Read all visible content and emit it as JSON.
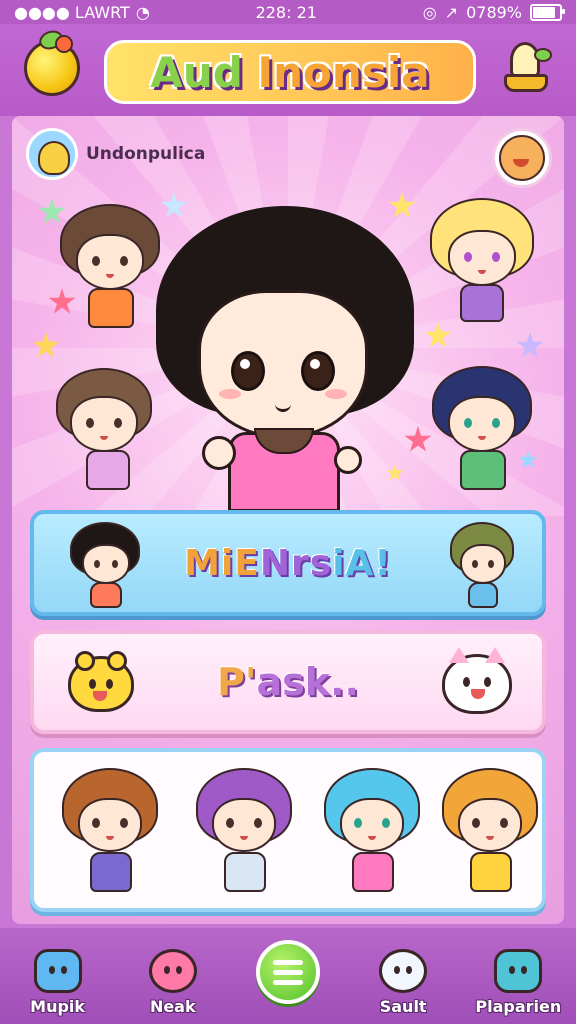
{
  "status_bar": {
    "carrier": "●●●● LAWRT",
    "time": "228: 21",
    "battery_text": "0789%",
    "battery_level": 0.78
  },
  "header": {
    "title_part1": "Aud",
    "title_part2": "Inonsia"
  },
  "profile": {
    "username": "Undonpulica"
  },
  "panels": {
    "banner_label_a": "MiE",
    "banner_label_b": "Nrs",
    "banner_label_c": "iA!",
    "pack_label_a": "P'",
    "pack_label_b": "ask.."
  },
  "bottom_nav": {
    "items": [
      {
        "label": "Mupik",
        "icon": "blue-cat-icon"
      },
      {
        "label": "Neak",
        "icon": "pink-bear-icon"
      },
      {
        "label": "",
        "icon": "menu-icon"
      },
      {
        "label": "Sault",
        "icon": "white-bunny-icon"
      },
      {
        "label": "Plaparien",
        "icon": "teal-monster-icon"
      }
    ]
  },
  "colors": {
    "accent_purple": "#b85bc9",
    "pink_bg": "#f6b3ea",
    "blue_panel": "#94d7f7",
    "green_button": "#52c12a"
  }
}
